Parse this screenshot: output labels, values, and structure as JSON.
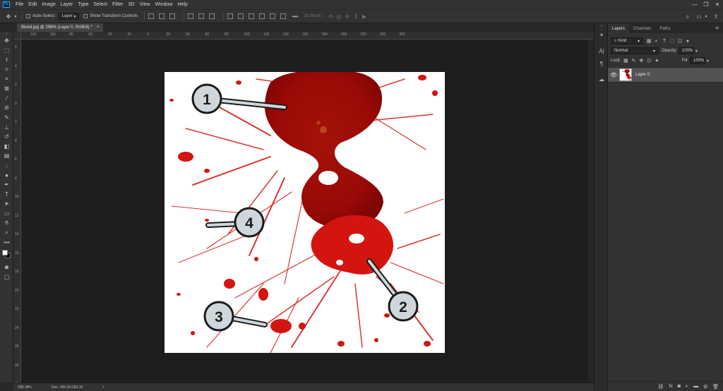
{
  "menu": [
    "File",
    "Edit",
    "Image",
    "Layer",
    "Type",
    "Select",
    "Filter",
    "3D",
    "View",
    "Window",
    "Help"
  ],
  "app_logo": "Ps",
  "window_controls": {
    "minimize": "—",
    "restore": "❐",
    "close": "✕"
  },
  "options": {
    "auto_select_label": "Auto-Select:",
    "auto_select_target": "Layer",
    "transform_label": "Show Transform Controls",
    "mode_3d": "3D Mode:"
  },
  "document": {
    "tab_title": "Blood.jpg @ 298% (Layer 0, RGB/8) *",
    "close": "×"
  },
  "rulers": {
    "horizontal": [
      "120",
      "100",
      "80",
      "60",
      "40",
      "20",
      "0",
      "20",
      "40",
      "60",
      "80",
      "100",
      "120",
      "140",
      "160",
      "180",
      "200",
      "220",
      "240",
      "260"
    ],
    "vertical": [
      "6",
      "4",
      "2",
      "0",
      "2",
      "4",
      "6",
      "8",
      "10",
      "12",
      "14",
      "16",
      "18",
      "20",
      "22",
      "24",
      "26",
      "28",
      "30"
    ]
  },
  "image": {
    "annotations": [
      {
        "label": "1"
      },
      {
        "label": "2"
      },
      {
        "label": "3"
      },
      {
        "label": "4"
      }
    ]
  },
  "status": {
    "zoom": "298.18%",
    "doc": "Doc: 183.1K/183.1K",
    "arrow": "›"
  },
  "panel": {
    "tabs": [
      "Layers",
      "Channels",
      "Paths"
    ],
    "filter_kind": "Kind",
    "blend_mode": "Normal",
    "opacity_label": "Opacity:",
    "opacity_value": "100%",
    "lock_label": "Lock:",
    "fill_label": "Fill:",
    "fill_value": "100%",
    "layer_name": "Layer 0",
    "footer_fx": "fx"
  },
  "colors": {
    "blood_dark": "#9c0a06",
    "blood_bright": "#d4140f",
    "canvas_bg": "#1e1e1e",
    "panel_bg": "#323232"
  }
}
